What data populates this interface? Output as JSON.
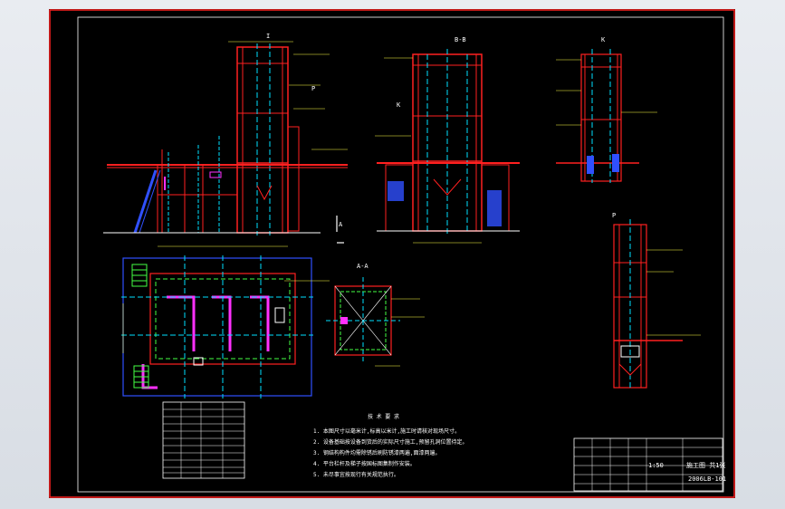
{
  "views": {
    "section_b": "B-B",
    "view_k": "K",
    "section_a": "A-A",
    "view_p": "P",
    "marker_i": "I",
    "marker_p": "P",
    "marker_k": "K",
    "marker_a": "A"
  },
  "title_block": {
    "drawing_no": "2006LB-101",
    "sheet_info": "施工图 共1张",
    "scale": "1:50"
  },
  "notes": {
    "heading": "技 术 要 求",
    "lines": [
      "1. 本图尺寸以毫米计,标高以米计,施工时请核对现场尺寸。",
      "2. 设备基础按设备到货后的实际尺寸施工,预留孔洞位置待定。",
      "3. 钢结构构件均需除锈后刷防锈漆两遍,面漆两遍。",
      "4. 平台栏杆及梯子按国标图集制作安装。",
      "5. 未尽事宜按现行有关规范执行。"
    ]
  },
  "colors": {
    "frame": "#ff2020",
    "steel": "#ff2020",
    "axis": "#00e0ff",
    "dim": "#ffff44",
    "text": "#ffffff",
    "equipment": "#3050ff",
    "highlight": "#ff30ff",
    "green": "#44ff44"
  }
}
